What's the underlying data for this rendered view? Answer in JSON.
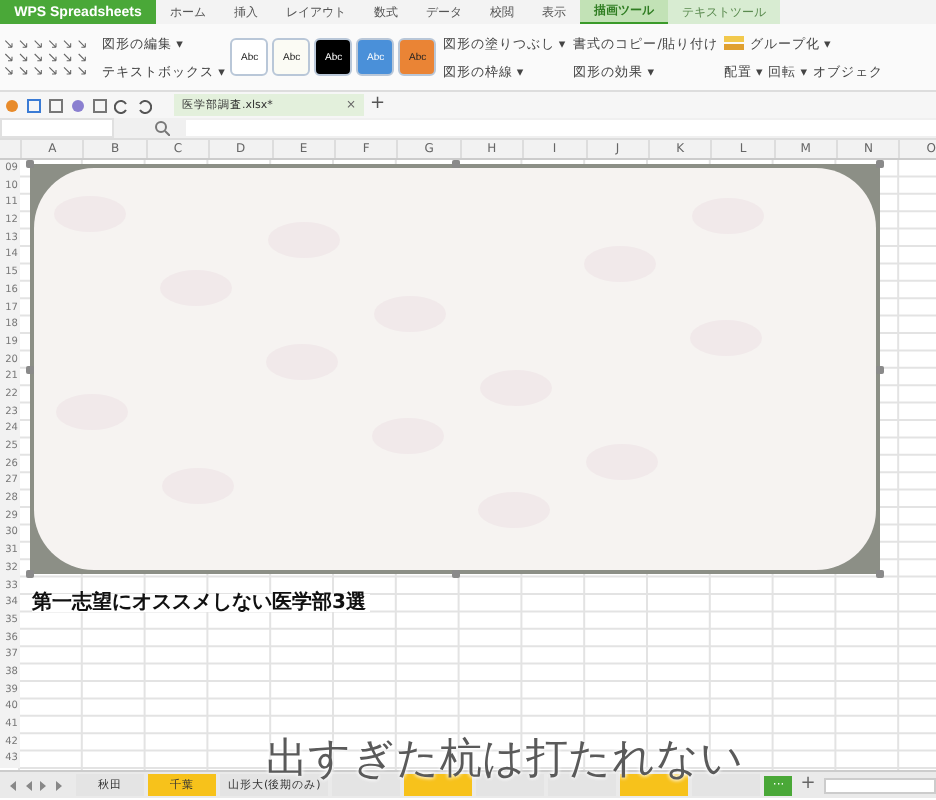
{
  "app_button": {
    "label": "WPS Spreadsheets"
  },
  "menu_tabs": [
    {
      "label": "ホーム",
      "selected": false,
      "kind": "normal"
    },
    {
      "label": "挿入",
      "selected": false,
      "kind": "normal"
    },
    {
      "label": "レイアウト",
      "selected": false,
      "kind": "normal"
    },
    {
      "label": "数式",
      "selected": false,
      "kind": "normal"
    },
    {
      "label": "データ",
      "selected": false,
      "kind": "normal"
    },
    {
      "label": "校閲",
      "selected": false,
      "kind": "normal"
    },
    {
      "label": "表示",
      "selected": false,
      "kind": "normal"
    },
    {
      "label": "描画ツール",
      "selected": true,
      "kind": "context"
    },
    {
      "label": "テキストツール",
      "selected": false,
      "kind": "context"
    }
  ],
  "ribbon": {
    "edit_shape": "図形の編集 ▾",
    "text_box": "テキストボックス ▾",
    "styles": [
      {
        "label": "Abc",
        "color": "#ffffff"
      },
      {
        "label": "Abc",
        "color": "#fbfbf4"
      },
      {
        "label": "Abc",
        "color": "#000000"
      },
      {
        "label": "Abc",
        "color": "#4a90d9"
      },
      {
        "label": "Abc",
        "color": "#ea8435"
      }
    ],
    "commands": [
      "図形の塗りつぶし ▾",
      "書式のコピー/貼り付け",
      "図形の枠線 ▾",
      "図形の効果 ▾"
    ],
    "arrange": [
      "配置 ▾",
      "回転 ▾"
    ],
    "group": "グループ化 ▾",
    "object": "オブジェク"
  },
  "doc_tab": {
    "title": "医学部調査.xlsx*",
    "close": "×",
    "add": "+"
  },
  "columns": [
    "A",
    "B",
    "C",
    "D",
    "E",
    "F",
    "G",
    "H",
    "I",
    "J",
    "K",
    "L",
    "M",
    "N",
    "O"
  ],
  "rows": [
    "09",
    "10",
    "11",
    "12",
    "13",
    "14",
    "15",
    "16",
    "17",
    "18",
    "19",
    "20",
    "21",
    "22",
    "23",
    "24",
    "25",
    "26",
    "27",
    "28",
    "29",
    "30",
    "31",
    "32",
    "33",
    "34",
    "35",
    "36",
    "37",
    "38",
    "39",
    "40",
    "41",
    "42",
    "43"
  ],
  "title_cell": {
    "text": "第一志望にオススメしない医学部3選"
  },
  "sheet_tabs": [
    {
      "label": "秋田",
      "color": "#e4e4e4"
    },
    {
      "label": "千葉",
      "color": "#f7c21b"
    },
    {
      "label": "山形大(後期のみ)",
      "color": "#e4e4e4"
    },
    {
      "color": "#e4e4e4"
    },
    {
      "color": "#f7c21b"
    },
    {
      "color": "#e4e4e4"
    },
    {
      "color": "#e4e4e4"
    },
    {
      "color": "#f7c21b"
    },
    {
      "color": "#e4e4e4"
    }
  ],
  "more_sheets": "···",
  "add_sheet": "+",
  "subtitle": "出すぎた杭は打たれない"
}
